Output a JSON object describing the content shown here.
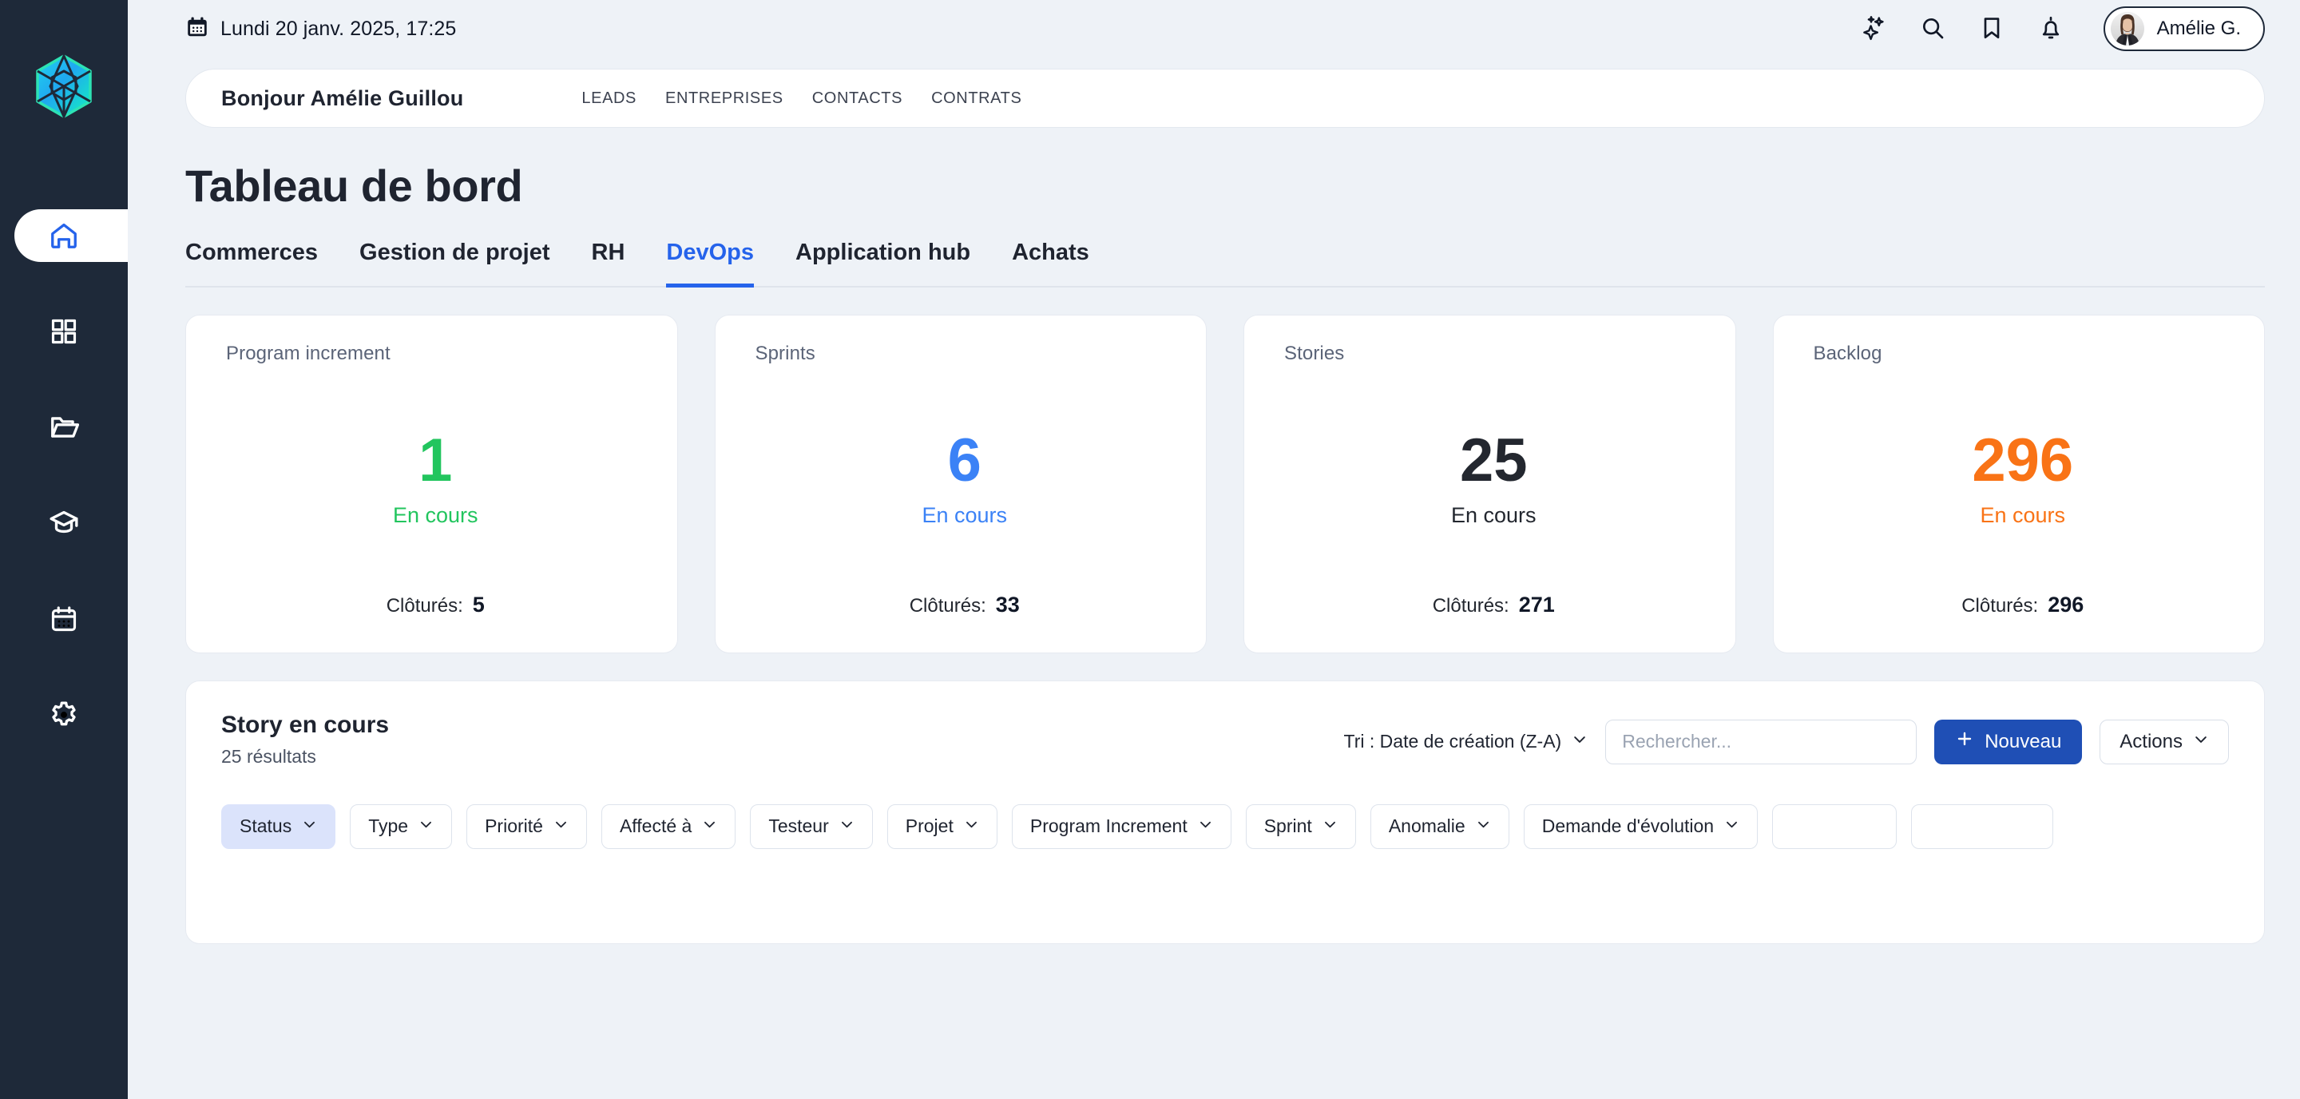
{
  "brand": {
    "logo_icon": "cube-hexagon-logo"
  },
  "sidebar": {
    "items": [
      {
        "name": "home",
        "icon": "home-icon",
        "active": true
      },
      {
        "name": "apps",
        "icon": "grid-apps-icon",
        "active": false
      },
      {
        "name": "files",
        "icon": "folder-open-icon",
        "active": false
      },
      {
        "name": "learning",
        "icon": "graduation-cap-icon",
        "active": false
      },
      {
        "name": "calendar",
        "icon": "calendar-icon",
        "active": false
      },
      {
        "name": "settings",
        "icon": "gear-icon",
        "active": false
      }
    ]
  },
  "topbar": {
    "calendar_icon": "calendar-icon",
    "date": "Lundi 20 janv. 2025, 17:25",
    "actions": [
      {
        "name": "ai-assistant",
        "icon": "sparkles-icon"
      },
      {
        "name": "search",
        "icon": "search-icon"
      },
      {
        "name": "bookmarks",
        "icon": "bookmark-icon"
      },
      {
        "name": "notifications",
        "icon": "bell-icon"
      }
    ],
    "user": {
      "name": "Amélie G.",
      "avatar": "user-avatar-photo"
    }
  },
  "greeting": {
    "title": "Bonjour Amélie Guillou",
    "nav": [
      {
        "label": "LEADS"
      },
      {
        "label": "ENTREPRISES"
      },
      {
        "label": "CONTACTS"
      },
      {
        "label": "CONTRATS"
      }
    ]
  },
  "page": {
    "title": "Tableau de bord",
    "tabs": [
      {
        "label": "Commerces",
        "active": false
      },
      {
        "label": "Gestion de projet",
        "active": false
      },
      {
        "label": "RH",
        "active": false
      },
      {
        "label": "DevOps",
        "active": true
      },
      {
        "label": "Application hub",
        "active": false
      },
      {
        "label": "Achats",
        "active": false
      }
    ]
  },
  "kpis": [
    {
      "label": "Program increment",
      "value": "1",
      "status": "En cours",
      "color": "#22c55e",
      "closed_label": "Clôturés:",
      "closed_value": "5"
    },
    {
      "label": "Sprints",
      "value": "6",
      "status": "En cours",
      "color": "#3b82f6",
      "closed_label": "Clôturés:",
      "closed_value": "33"
    },
    {
      "label": "Stories",
      "value": "25",
      "status": "En cours",
      "color": "#23272f",
      "closed_label": "Clôturés:",
      "closed_value": "271"
    },
    {
      "label": "Backlog",
      "value": "296",
      "status": "En cours",
      "color": "#f97316",
      "closed_label": "Clôturés:",
      "closed_value": "296"
    }
  ],
  "panel": {
    "title": "Story en cours",
    "subtitle": "25 résultats",
    "sort_label": "Tri : Date de création (Z-A)",
    "search_placeholder": "Rechercher...",
    "search_value": "",
    "new_button": "Nouveau",
    "actions_button": "Actions",
    "filters": [
      {
        "label": "Status",
        "active": true
      },
      {
        "label": "Type",
        "active": false
      },
      {
        "label": "Priorité",
        "active": false
      },
      {
        "label": "Affecté à",
        "active": false
      },
      {
        "label": "Testeur",
        "active": false
      },
      {
        "label": "Projet",
        "active": false
      },
      {
        "label": "Program Increment",
        "active": false
      },
      {
        "label": "Sprint",
        "active": false
      },
      {
        "label": "Anomalie",
        "active": false
      },
      {
        "label": "Demande d'évolution",
        "active": false
      }
    ]
  },
  "colors": {
    "sidebar_bg": "#1e2939",
    "page_bg": "#eef2f7",
    "accent_blue": "#2563eb",
    "primary_button": "#1f4fb5",
    "chip_active_bg": "#dbe3fb"
  }
}
